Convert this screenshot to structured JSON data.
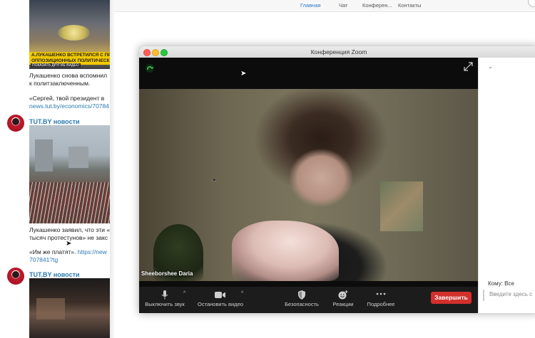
{
  "feed": {
    "post1": {
      "image_caption_1": "А.ЛУКАШЕНКО ВСТРЕТИЛСЯ С ПРЕДСТ",
      "image_caption_2": "ОППОЗИЦИОННЫХ ПОЛИТИЧЕСКИХ ДВ",
      "image_caption_3": "ПОКАЗАТЬ ДРУГИЕ ВИДЕО",
      "text_line1": "Лукашенко снова вспомнил",
      "text_line2": "к политзаключенным.",
      "text_line3": "«Сергей, твой президент в",
      "link": "news.tut.by/economics/70784"
    },
    "channel": "TUT.BY новости",
    "post2": {
      "text_line1": "Лукашенко заявил, что эти «",
      "text_line2": "тысяч протестунов» не закс",
      "text_line3_prefix": "«Им же платят». ",
      "text_line3_link": "https://new",
      "link_line2": "707841?tg"
    },
    "channel2": "TUT.BY новости"
  },
  "browser_nav": {
    "tabs": [
      "Главная",
      "Чат",
      "Конферен...",
      "Контакты"
    ],
    "active_tab": "Главная"
  },
  "zoom": {
    "window_title": "Конференция Zoom",
    "participant_name": "Sheeborshee Daria",
    "controls": {
      "mute": "Выключить звук",
      "stop_video": "Остановить видео",
      "security": "Безопасность",
      "reactions": "Реакции",
      "more": "Подробнее",
      "end": "Завершить"
    },
    "chat": {
      "to_label": "Кому: Все",
      "input_placeholder": "Введите здесь с"
    }
  },
  "colors": {
    "accent_blue": "#2b78c8",
    "end_red": "#d3302c",
    "link_blue": "#2a7ab3"
  }
}
